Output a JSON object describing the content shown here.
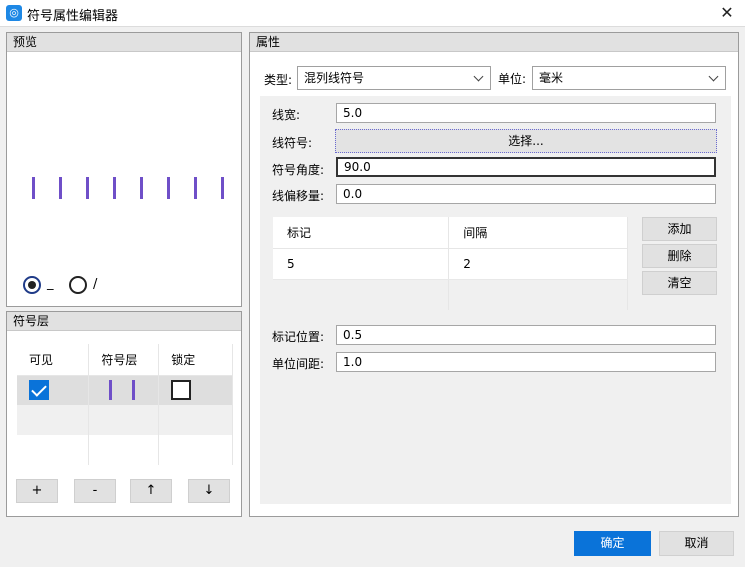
{
  "window": {
    "title": "符号属性编辑器"
  },
  "preview": {
    "header": "预览",
    "mark_count": 8,
    "mark_color": "#6f4fc8",
    "radio_options": [
      {
        "label": "_",
        "selected": true
      },
      {
        "label": "/",
        "selected": false
      }
    ]
  },
  "layers": {
    "header": "符号层",
    "columns": [
      "可见",
      "符号层",
      "锁定"
    ],
    "rows": [
      {
        "visible": true,
        "locked": false
      }
    ],
    "buttons": [
      "+",
      "-",
      "↑",
      "↓"
    ]
  },
  "properties": {
    "header": "属性",
    "type_label": "类型:",
    "type_value": "混列线符号",
    "unit_label": "单位:",
    "unit_value": "毫米",
    "line_width_label": "线宽:",
    "line_width_value": "5.0",
    "line_symbol_label": "线符号:",
    "select_button": "选择...",
    "symbol_angle_label": "符号角度:",
    "symbol_angle_value": "90.0",
    "line_offset_label": "线偏移量:",
    "line_offset_value": "0.0",
    "marks_table": {
      "columns": [
        "标记",
        "间隔"
      ],
      "rows": [
        {
          "mark": "5",
          "interval": "2"
        }
      ]
    },
    "add_button": "添加",
    "delete_button": "删除",
    "clear_button": "清空",
    "mark_position_label": "标记位置:",
    "mark_position_value": "0.5",
    "unit_spacing_label": "单位间距:",
    "unit_spacing_value": "1.0"
  },
  "footer": {
    "ok": "确定",
    "cancel": "取消"
  },
  "colors": {
    "accent": "#0a73d9",
    "mark": "#6f4fc8"
  }
}
